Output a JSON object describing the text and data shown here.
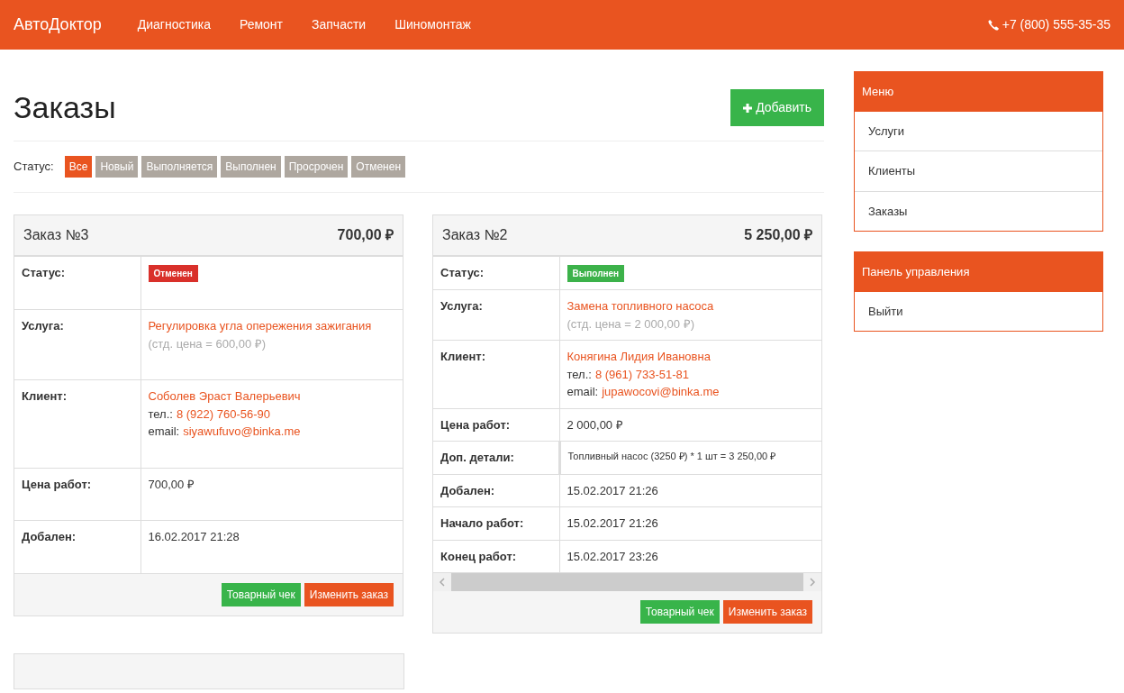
{
  "navbar": {
    "brand": "АвтоДоктор",
    "links": [
      "Диагностика",
      "Ремонт",
      "Запчасти",
      "Шиномонтаж"
    ],
    "phone": "+7 (800) 555-35-35"
  },
  "page": {
    "title": "Заказы",
    "add_button": "Добавить"
  },
  "filter": {
    "label": "Статус:",
    "options": [
      {
        "label": "Все",
        "selected": true
      },
      {
        "label": "Новый",
        "selected": false
      },
      {
        "label": "Выполняется",
        "selected": false
      },
      {
        "label": "Выполнен",
        "selected": false
      },
      {
        "label": "Просрочен",
        "selected": false
      },
      {
        "label": "Отменен",
        "selected": false
      }
    ]
  },
  "orders": [
    {
      "kind": "full",
      "title": "Заказ №3",
      "total": "700,00 ₽",
      "scrollbar": false,
      "rows": [
        {
          "kind": "status",
          "label": "Статус:",
          "value": "Отменен",
          "color": "#d9302a"
        },
        {
          "kind": "service",
          "label": "Услуга:",
          "value": "Регулировка угла опережения зажигания",
          "note": "(стд. цена = 600,00 ₽)"
        },
        {
          "kind": "client",
          "label": "Клиент:",
          "value": "Соболев Эраст Валерьевич",
          "phone_label": "тел.:",
          "phone": "8 (922) 760-56-90",
          "email_label": "email:",
          "email": "siyawufuvo@binka.me"
        },
        {
          "kind": "text",
          "label": "Цена работ:",
          "value": "700,00 ₽"
        },
        {
          "kind": "text",
          "label": "Добален:",
          "value": "16.02.2017 21:28"
        }
      ],
      "buttons": [
        "Товарный чек",
        "Изменить заказ"
      ]
    },
    {
      "kind": "full",
      "title": "Заказ №2",
      "total": "5 250,00 ₽",
      "scrollbar": true,
      "rows": [
        {
          "kind": "status",
          "label": "Статус:",
          "value": "Выполнен",
          "color": "#3cb24a"
        },
        {
          "kind": "service",
          "label": "Услуга:",
          "value": "Замена топливного насоса",
          "note": "(стд. цена = 2 000,00 ₽)"
        },
        {
          "kind": "client",
          "label": "Клиент:",
          "value": "Конягина Лидия Ивановна",
          "phone_label": "тел.:",
          "phone": "8 (961) 733-51-81",
          "email_label": "email:",
          "email": "jupawocovi@binka.me"
        },
        {
          "kind": "text",
          "label": "Цена работ:",
          "value": "2 000,00 ₽"
        },
        {
          "kind": "small",
          "label": "Доп. детали:",
          "value": "Топливный насос (3250 ₽) * 1 шт = 3 250,00 ₽"
        },
        {
          "kind": "text",
          "label": "Добален:",
          "value": "15.02.2017 21:26"
        },
        {
          "kind": "text",
          "label": "Начало работ:",
          "value": "15.02.2017 21:26"
        },
        {
          "kind": "text",
          "label": "Конец работ:",
          "value": "15.02.2017 23:26"
        }
      ],
      "buttons": [
        "Товарный чек",
        "Изменить заказ"
      ]
    },
    {
      "kind": "stub"
    }
  ],
  "sidebar": [
    {
      "title": "Меню",
      "items": [
        "Услуги",
        "Клиенты",
        "Заказы"
      ]
    },
    {
      "title": "Панель управления",
      "items": [
        "Выйти"
      ]
    }
  ]
}
